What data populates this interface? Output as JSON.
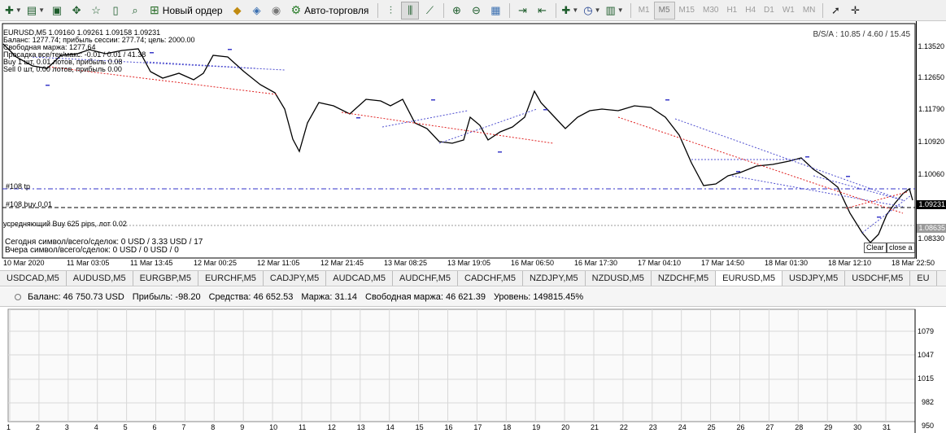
{
  "toolbar": {
    "new_order_label": "Новый ордер",
    "auto_trading_label": "Авто-торговля",
    "timeframes": [
      "M1",
      "M5",
      "M15",
      "M30",
      "H1",
      "H4",
      "D1",
      "W1",
      "MN"
    ],
    "active_timeframe": "M5"
  },
  "chart": {
    "header": "EURUSD,M5  1.09160 1.09261 1.09158 1.09231",
    "info_lines": [
      "Баланс: 1277.74; прибыль сессии: 277.74; цель: 2000.00",
      "Свободная маржа: 1277.64",
      "Просадка все/тек/макс: -0.01 / 0.01 / 41.38",
      "Buy   1 шт, 0.01 лотов, прибыль 0.08",
      "Sell  0 шт, 0.00 лотов, прибыль 0.00"
    ],
    "bsa": "B/S/A : 10.85 / 4.60 / 15.45",
    "tp_label": "#108 tp",
    "buy_label": "#108 buy 0.01",
    "averaging_label": "усредняющий Buy 625 pips, лот 0.02",
    "today_stats": "Сегодня символ/всего/сделок: 0 USD / 3.33 USD / 17",
    "yesterday_stats": "Вчера символ/всего/сделок: 0 USD / 0 USD / 0",
    "clear_button": "Clear",
    "close_button": "close a",
    "price_labels": [
      "1.13520",
      "1.12650",
      "1.11790",
      "1.10920",
      "1.10060",
      "1.09231",
      "1.08635",
      "1.08330"
    ],
    "current_price": "1.09231",
    "pending_price": "1.08635",
    "time_labels": [
      "10 Mar 2020",
      "11 Mar 03:05",
      "11 Mar 13:45",
      "12 Mar 00:25",
      "12 Mar 11:05",
      "12 Mar 21:45",
      "13 Mar 08:25",
      "13 Mar 19:05",
      "16 Mar 06:50",
      "16 Mar 17:30",
      "17 Mar 04:10",
      "17 Mar 14:50",
      "18 Mar 01:30",
      "18 Mar 12:10",
      "18 Mar 22:50"
    ]
  },
  "tabs": [
    "USDCAD,M5",
    "AUDUSD,M5",
    "EURGBP,M5",
    "EURCHF,M5",
    "CADJPY,M5",
    "AUDCAD,M5",
    "AUDCHF,M5",
    "CADCHF,M5",
    "NZDJPY,M5",
    "NZDUSD,M5",
    "NZDCHF,M5",
    "EURUSD,M5",
    "USDJPY,M5",
    "USDCHF,M5",
    "EU"
  ],
  "account": {
    "balance": "Баланс: 46 750.73 USD",
    "profit": "Прибыль: -98.20",
    "equity": "Средства: 46 652.53",
    "margin": "Маржа: 31.14",
    "free_margin": "Свободная маржа: 46 621.39",
    "level": "Уровень: 149815.45%"
  },
  "indicator": {
    "y_labels": [
      "1079",
      "1047",
      "1015",
      "982",
      "950"
    ],
    "x_labels": [
      "1",
      "2",
      "3",
      "4",
      "5",
      "6",
      "7",
      "8",
      "9",
      "10",
      "11",
      "12",
      "13",
      "14",
      "15",
      "16",
      "17",
      "18",
      "19",
      "20",
      "21",
      "22",
      "23",
      "24",
      "25",
      "26",
      "27",
      "28",
      "29",
      "30",
      "31"
    ]
  },
  "colors": {
    "price_line": "#000000",
    "current_price_box": "#000000",
    "pending_price_box": "#9a9a9a",
    "tp_line": "#3030c8",
    "buy_line": "#000000",
    "trade_dot_lines": "#5050d0",
    "avg_line": "#e02020"
  }
}
